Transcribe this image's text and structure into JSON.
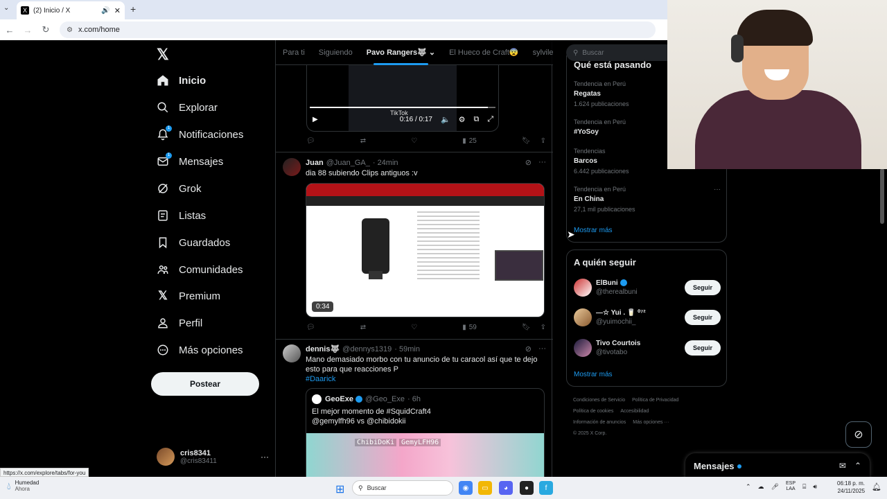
{
  "browser": {
    "tab_title": "(2) Inicio / X",
    "url": "x.com/home",
    "status_url": "https://x.com/explore/tabs/for-you"
  },
  "nav": {
    "items": [
      {
        "label": "Inicio",
        "icon": "home-icon",
        "active": true
      },
      {
        "label": "Explorar",
        "icon": "search-icon"
      },
      {
        "label": "Notificaciones",
        "icon": "bell-icon",
        "badge": "1"
      },
      {
        "label": "Mensajes",
        "icon": "envelope-icon",
        "badge": "1"
      },
      {
        "label": "Grok",
        "icon": "grok-icon"
      },
      {
        "label": "Listas",
        "icon": "list-icon"
      },
      {
        "label": "Guardados",
        "icon": "bookmark-icon"
      },
      {
        "label": "Comunidades",
        "icon": "communities-icon"
      },
      {
        "label": "Premium",
        "icon": "x-icon"
      },
      {
        "label": "Perfil",
        "icon": "person-icon"
      },
      {
        "label": "Más opciones",
        "icon": "more-circle-icon"
      }
    ],
    "post_label": "Postear",
    "user": {
      "name": "cris8341",
      "handle": "@cris83411"
    }
  },
  "feed_tabs": [
    {
      "label": "Para ti"
    },
    {
      "label": "Siguiendo"
    },
    {
      "label": "Pavo Rangers🐺 ⌄",
      "active": true
    },
    {
      "label": "El Hueco de Craft😨"
    },
    {
      "label": "sylvile"
    }
  ],
  "video1": {
    "time": "0:16 / 0:17",
    "watermark": "TikTok",
    "progress": 0.96,
    "views": "25"
  },
  "tweets": [
    {
      "name": "Juan",
      "handle": "@Juan_GA_",
      "time": "· 24min",
      "text": "dia 88 subiendo Clips antiguos :v",
      "duration": "0:34",
      "views": "59"
    },
    {
      "name": "dennis🐺",
      "handle": "@dennys1319",
      "time": "· 59min",
      "text": "Mano demasiado morbo con tu anuncio de tu caracol así que te dejo esto para que reacciones P",
      "hashtag": "#Daarick",
      "quote": {
        "name": "GeoExe",
        "handle": "@Geo_Exe",
        "time": "· 6h",
        "line1": "El mejor momento de #SquidCraft4",
        "line2": "@gemylfh96 vs @chibidokii",
        "label_left": "ChibiDoKi",
        "label_right": "GemyLFH96"
      }
    }
  ],
  "search": {
    "placeholder": "Buscar"
  },
  "trends": {
    "title": "Qué está pasando",
    "items": [
      {
        "category": "Tendencia en Perú",
        "name": "Regatas",
        "count": "1.624 publicaciones"
      },
      {
        "category": "Tendencia en Perú",
        "name": "#YoSoy",
        "count": ""
      },
      {
        "category": "Tendencias",
        "name": "Barcos",
        "count": "6.442 publicaciones"
      },
      {
        "category": "Tendencia en Perú",
        "name": "En China",
        "count": "27,1 mil publicaciones"
      }
    ],
    "more": "Mostrar más"
  },
  "who_to_follow": {
    "title": "A quién seguir",
    "items": [
      {
        "name": "ElBuni",
        "handle": "@therealbuni",
        "button": "Seguir",
        "verified": true
      },
      {
        "name": "—☆ Yui . 🥛 ⁰⁷²",
        "handle": "@yuimochii_",
        "button": "Seguir"
      },
      {
        "name": "Tivo Courtois",
        "handle": "@tivotabo",
        "button": "Seguir"
      }
    ],
    "more": "Mostrar más"
  },
  "footer": {
    "links": [
      "Condiciones de Servicio",
      "Política de Privacidad",
      "Política de cookies",
      "Accesibilidad",
      "Información de anuncios",
      "Más opciones ···"
    ],
    "copyright": "© 2025 X Corp."
  },
  "messages_drawer": {
    "title": "Mensajes"
  },
  "taskbar": {
    "weather_title": "Humedad",
    "weather_sub": "Ahora",
    "search": "Buscar",
    "lang_top": "ESP",
    "lang_bottom": "LAA",
    "time": "06:18 p. m.",
    "date": "24/11/2025"
  },
  "colors": {
    "accent": "#1d9bf0",
    "bg": "#000000",
    "text": "#e7e9ea",
    "muted": "#71767b"
  }
}
